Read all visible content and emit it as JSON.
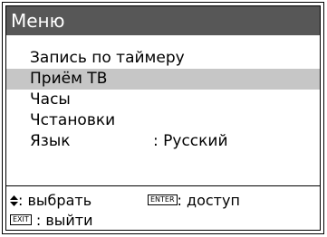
{
  "menu_title": "Меню",
  "items": [
    {
      "label": "Запись по таймеру",
      "selected": false
    },
    {
      "label": "Приём ТВ",
      "selected": true
    },
    {
      "label": "Часы",
      "selected": false
    },
    {
      "label": "Чстановки",
      "selected": false
    },
    {
      "label": "Язык",
      "value": ": Русский",
      "selected": false
    }
  ],
  "footer": {
    "select_icon": "up-down-arrows-icon",
    "select_text": ": выбрать",
    "enter_key": "ENTER",
    "enter_text": ": доступ",
    "exit_key": "EXIT",
    "exit_text": " : выйти"
  },
  "colors": {
    "title_bar": "#575757",
    "highlight": "#c6c6c6"
  }
}
